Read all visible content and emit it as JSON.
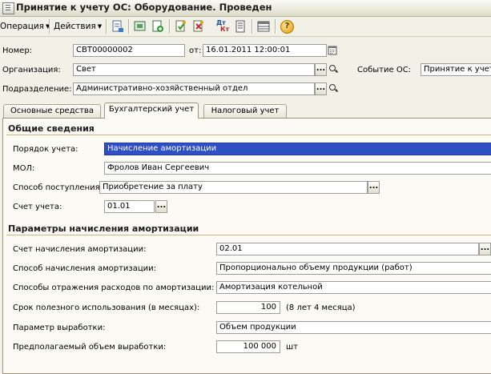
{
  "window": {
    "title": "Принятие к учету ОС: Оборудование. Проведен"
  },
  "toolbar": {
    "operation_label": "Операция",
    "actions_label": "Действия",
    "buttons": [
      "new-doc-icon",
      "copy-icon",
      "post-icon",
      "unpost-icon",
      "dt-kt-icon",
      "journal-icon",
      "list-icon",
      "help-icon"
    ],
    "dtkt_top": "Дт",
    "dtkt_bottom": "Кт",
    "help_glyph": "?"
  },
  "header": {
    "number_label": "Номер:",
    "number_value": "СВТ00000002",
    "date_label": "от:",
    "date_value": "16.01.2011 12:00:01",
    "org_label": "Организация:",
    "org_value": "Свет",
    "dept_label": "Подразделение:",
    "dept_value": "Административно-хозяйственный отдел",
    "event_label": "Событие ОС:",
    "event_value": "Принятие к учету"
  },
  "tabs": [
    {
      "label": "Основные средства",
      "active": false
    },
    {
      "label": "Бухгалтерский учет",
      "active": true
    },
    {
      "label": "Налоговый учет",
      "active": false
    }
  ],
  "general": {
    "title": "Общие сведения",
    "order_label": "Порядок учета:",
    "order_value": "Начисление амортизации",
    "mol_label": "МОЛ:",
    "mol_value": "Фролов Иван  Сергеевич",
    "receipt_label": "Способ поступления:",
    "receipt_value": "Приобретение за плату",
    "account_label": "Счет учета:",
    "account_value": "01.01"
  },
  "depreciation": {
    "title": "Параметры начисления амортизации",
    "account_label": "Счет начисления амортизации:",
    "account_value": "02.01",
    "method_label": "Способ начисления амортизации:",
    "method_value": "Пропорционально объему продукции (работ)",
    "expense_label": "Способы отражения расходов по амортизации:",
    "expense_value": "Амортизация котельной",
    "life_label": "Срок полезного использования (в месяцах):",
    "life_value": "100",
    "life_hint": "(8 лет 4 месяца)",
    "param_label": "Параметр выработки:",
    "param_value": "Объем продукции",
    "volume_label": "Предполагаемый объем выработки:",
    "volume_value": "100 000",
    "volume_unit": "шт"
  },
  "ellipsis": "...",
  "colors": {
    "selection": "#2f4fc4",
    "section_line": "#c9b87a",
    "background": "#f2f1e8"
  }
}
